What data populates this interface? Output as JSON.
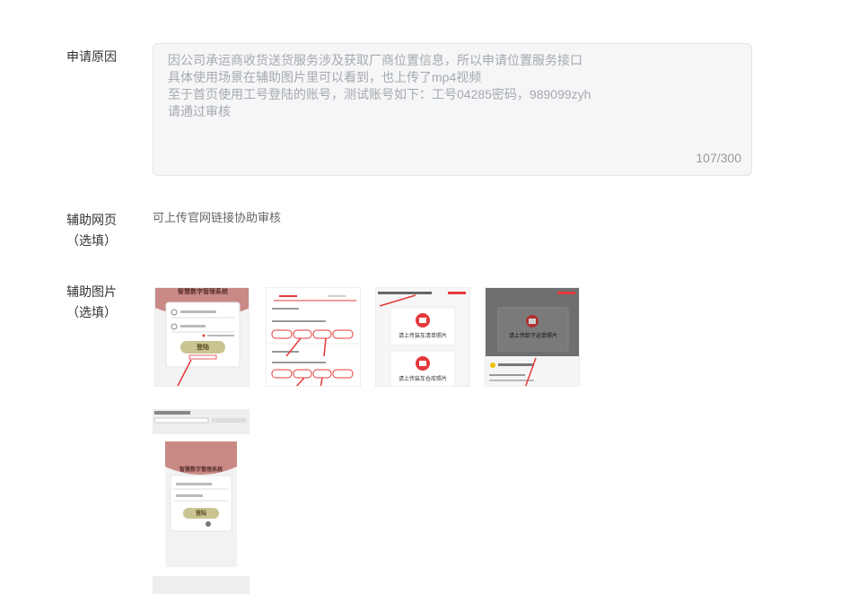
{
  "reason": {
    "label": "申请原因",
    "text": "因公司承运商收货送货服务涉及获取厂商位置信息，所以申请位置服务接口\n具体使用场景在辅助图片里可以看到，也上传了mp4视频\n至于首页使用工号登陆的账号，测试账号如下：工号04285密码，989099zyh\n请通过审核",
    "counter": "107/300"
  },
  "webpage": {
    "label_line1": "辅助网页",
    "label_line2": "（选填）",
    "hint": "可上传官网链接协助审核"
  },
  "images": {
    "label_line1": "辅助图片",
    "label_line2": "（选填）",
    "thumbs": [
      {
        "name": "login-screenshot",
        "title": "智慧数字管理系统",
        "button": "登陆"
      },
      {
        "name": "tabs-screenshot"
      },
      {
        "name": "upload-screenshot",
        "line1": "请上传装车清单照片",
        "line2": "请上传装车仓库照片"
      },
      {
        "name": "dialog-screenshot",
        "line1": "请上传卸下运单照片"
      },
      {
        "name": "browser-login-screenshot",
        "title": "智慧数字管理系统",
        "button": "登陆"
      }
    ]
  },
  "colors": {
    "accent_red": "#e5393a",
    "brand_pink": "#c98a86",
    "button_olive": "#c9c492"
  }
}
